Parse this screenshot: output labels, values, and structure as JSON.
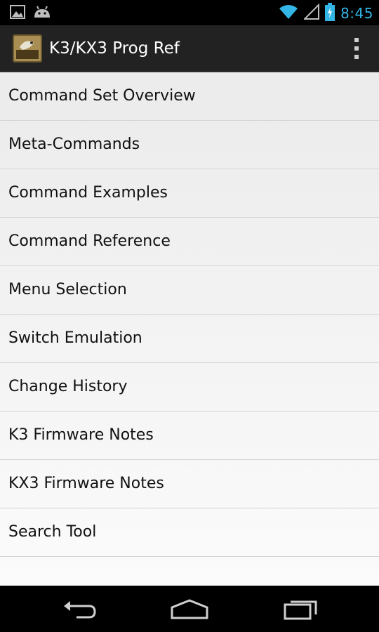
{
  "status_bar": {
    "time": "8:45",
    "left_icons": [
      "image-icon",
      "android-icon"
    ],
    "right_icons": [
      "wifi-icon",
      "signal-icon",
      "battery-charging-icon"
    ],
    "clock_color": "#33b5e5"
  },
  "action_bar": {
    "title": "K3/KX3 Prog Ref",
    "overflow_icon": "overflow-menu-icon",
    "background": "#222222"
  },
  "menu": {
    "items": [
      {
        "label": "Command Set Overview"
      },
      {
        "label": "Meta-Commands"
      },
      {
        "label": "Command Examples"
      },
      {
        "label": "Command Reference"
      },
      {
        "label": "Menu Selection"
      },
      {
        "label": "Switch Emulation"
      },
      {
        "label": "Change History"
      },
      {
        "label": "K3 Firmware Notes"
      },
      {
        "label": "KX3 Firmware Notes"
      },
      {
        "label": "Search Tool"
      }
    ]
  },
  "nav_bar": {
    "buttons": [
      "back-icon",
      "home-icon",
      "recent-apps-icon"
    ]
  }
}
